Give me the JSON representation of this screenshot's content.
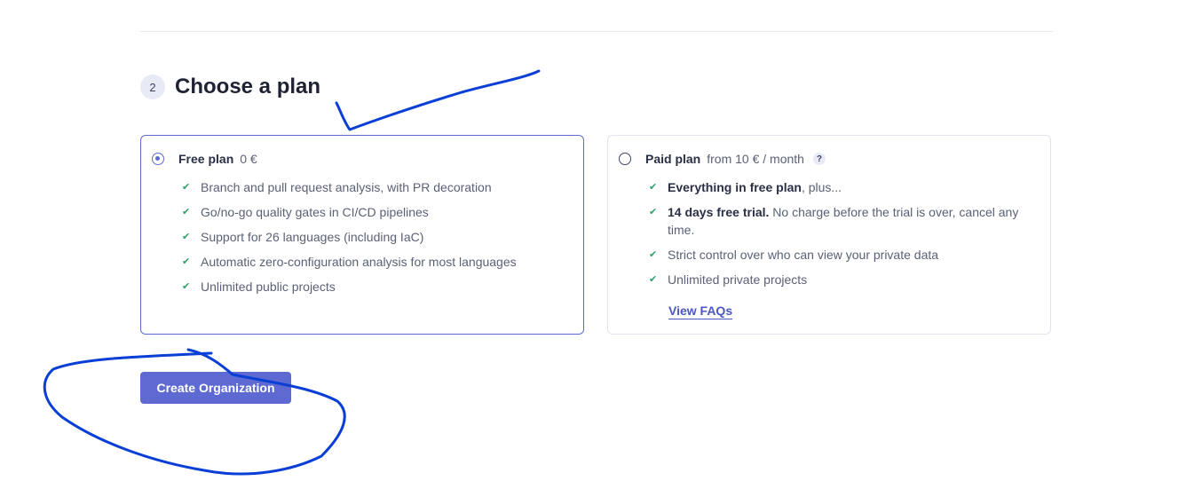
{
  "step": {
    "number": "2",
    "title": "Choose a plan"
  },
  "plans": {
    "free": {
      "name": "Free plan",
      "price": "0 €",
      "selected": true,
      "features": [
        "Branch and pull request analysis, with PR decoration",
        "Go/no-go quality gates in CI/CD pipelines",
        "Support for 26 languages (including IaC)",
        "Automatic zero-configuration analysis for most languages",
        "Unlimited public projects"
      ]
    },
    "paid": {
      "name": "Paid plan",
      "price": "from 10 € / month",
      "help_icon": "?",
      "selected": false,
      "features": [
        {
          "bold": "Everything in free plan",
          "rest": ", plus..."
        },
        {
          "bold": "14 days free trial.",
          "rest": " No charge before the trial is over, cancel any time."
        },
        {
          "bold": "",
          "rest": "Strict control over who can view your private data"
        },
        {
          "bold": "",
          "rest": "Unlimited private projects"
        }
      ],
      "faq_link": "View FAQs"
    }
  },
  "actions": {
    "create_label": "Create Organization"
  },
  "icons": {
    "check": "✔",
    "help": "question-icon",
    "radio_selected": "radio-checked-icon",
    "radio_unselected": "radio-unchecked-icon"
  },
  "colors": {
    "accent": "#5e6ad2",
    "check": "#2e9e6b",
    "annotation": "#0a3fd6"
  }
}
